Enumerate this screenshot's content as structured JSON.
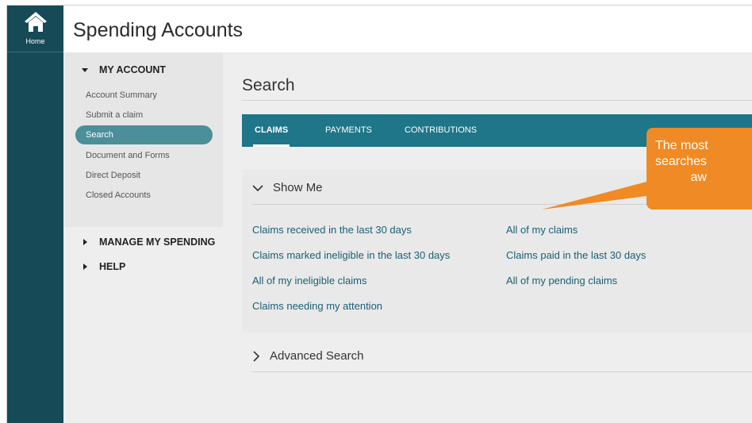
{
  "rail": {
    "home_label": "Home",
    "home_icon": "home-icon"
  },
  "header": {
    "title": "Spending Accounts"
  },
  "sidebar": {
    "sections": [
      {
        "label": "MY ACCOUNT",
        "expanded": true
      },
      {
        "label": "MANAGE MY SPENDING",
        "expanded": false
      },
      {
        "label": "HELP",
        "expanded": false
      }
    ],
    "items": [
      {
        "label": "Account Summary"
      },
      {
        "label": "Submit a claim"
      },
      {
        "label": "Search",
        "active": true
      },
      {
        "label": "Document and Forms"
      },
      {
        "label": "Direct Deposit"
      },
      {
        "label": "Closed Accounts"
      }
    ]
  },
  "main": {
    "title": "Search",
    "tabs": [
      {
        "label": "CLAIMS",
        "active": true
      },
      {
        "label": "PAYMENTS"
      },
      {
        "label": "CONTRIBUTIONS"
      }
    ],
    "show_me": {
      "label": "Show Me",
      "links": [
        "Claims received in the last 30 days",
        "All of my claims",
        "Claims marked ineligible in the last 30 days",
        "Claims paid in the last 30 days",
        "All of my ineligible claims",
        "All of my pending claims",
        "Claims needing my attention"
      ]
    },
    "advanced": {
      "label": "Advanced Search"
    }
  },
  "callout": {
    "text": "The most\nsearches \n          aw"
  },
  "colors": {
    "rail": "#154a56",
    "tab_bar": "#1e7688",
    "active_item": "#4a8f9a",
    "link": "#1a5f74",
    "callout": "#f08a24"
  }
}
